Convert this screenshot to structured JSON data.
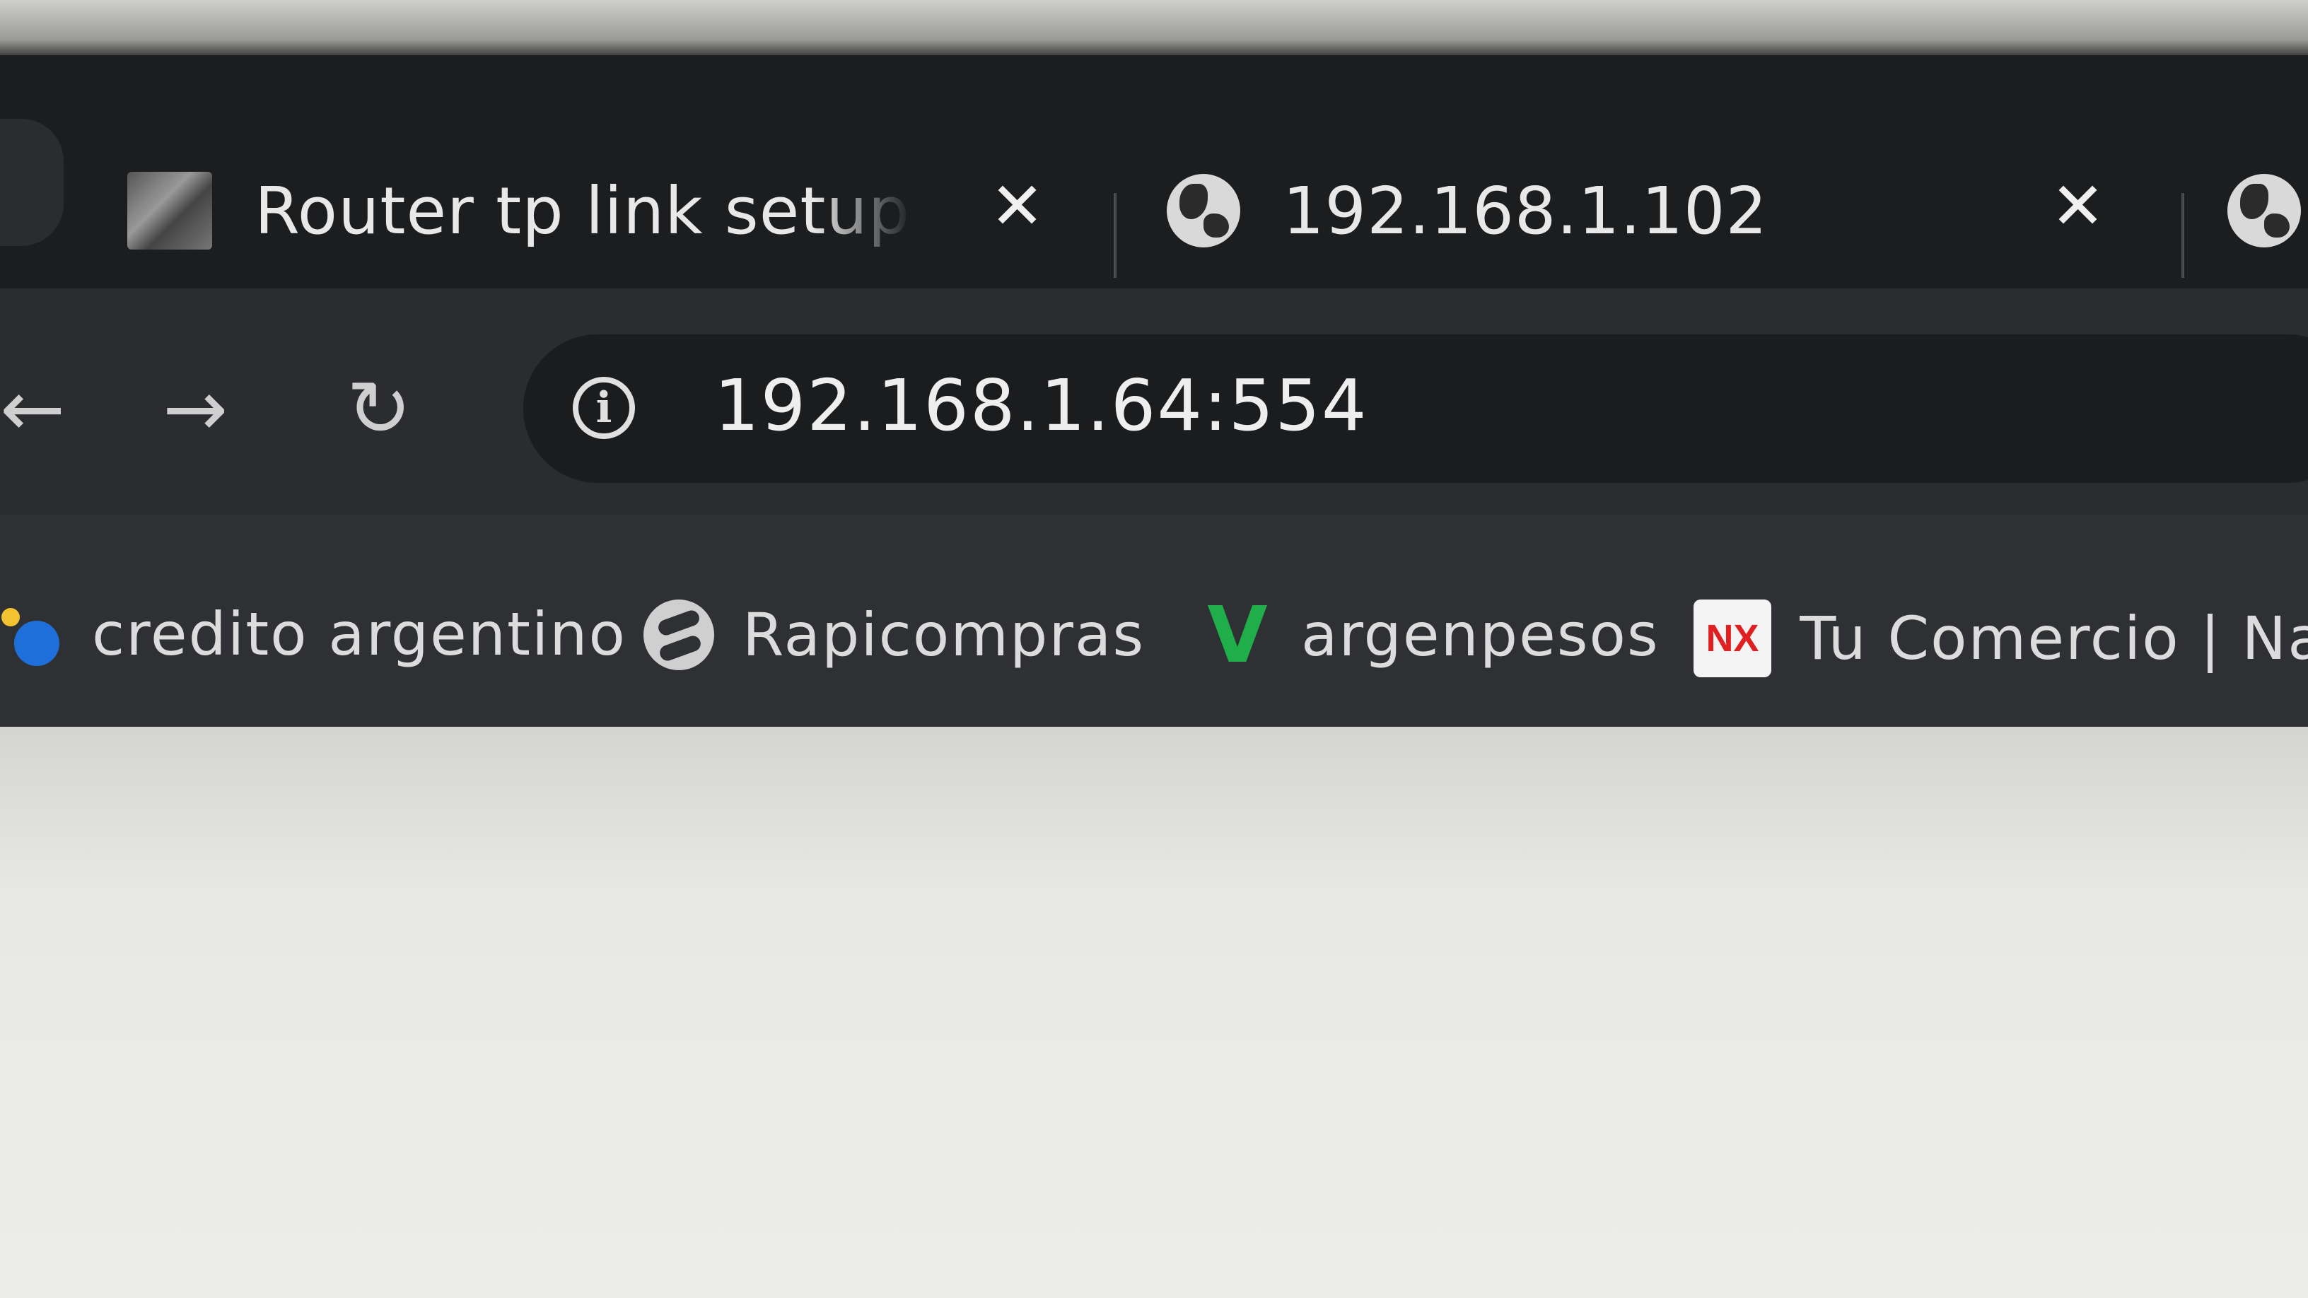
{
  "tabs": [
    {
      "title": "Router tp link setup | In",
      "close": "✕",
      "icon": "page-thumbnail-icon"
    },
    {
      "title": "192.168.1.102",
      "close": "✕",
      "icon": "globe-icon"
    }
  ],
  "toolbar": {
    "back": "←",
    "forward": "→",
    "reload": "↻",
    "info": "i",
    "url": "192.168.1.64:554"
  },
  "bookmarks": [
    {
      "label": "credito argentino",
      "icon": "blue-circle-icon"
    },
    {
      "label": "Rapicompras",
      "icon": "swirl-icon"
    },
    {
      "label": "argenpesos",
      "icon": "green-v-icon",
      "icon_text": "V"
    },
    {
      "label": "Tu Comercio | Na",
      "icon": "nx-icon",
      "icon_text": "NX"
    }
  ]
}
